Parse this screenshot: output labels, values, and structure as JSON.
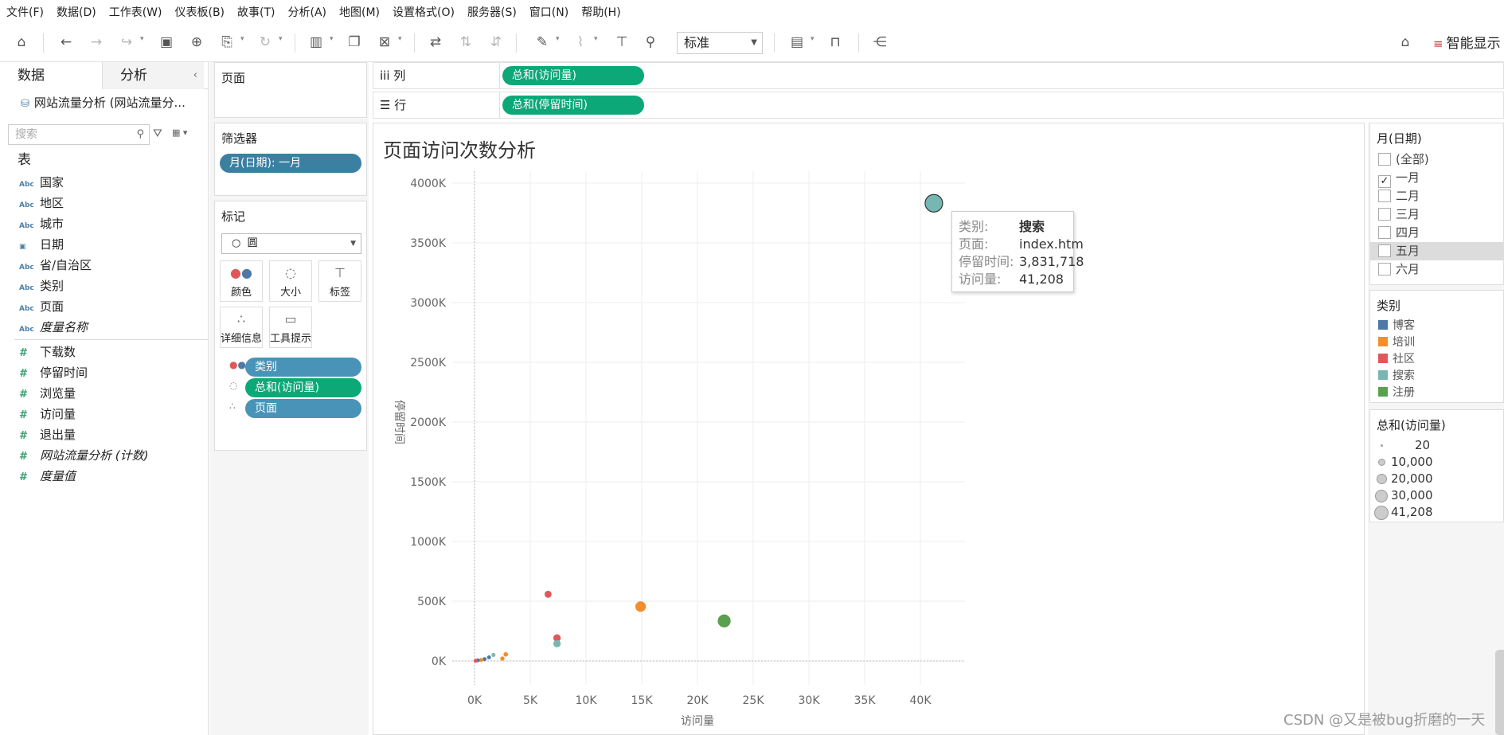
{
  "menu": [
    "文件(F)",
    "数据(D)",
    "工作表(W)",
    "仪表板(B)",
    "故事(T)",
    "分析(A)",
    "地图(M)",
    "设置格式(O)",
    "服务器(S)",
    "窗口(N)",
    "帮助(H)"
  ],
  "toolbar": {
    "fit_value": "标准",
    "smart_label": "智能显示"
  },
  "data_pane": {
    "tabs": [
      "数据",
      "分析"
    ],
    "datasource": "网站流量分析 (网站流量分...",
    "search_placeholder": "搜索",
    "table_header": "表",
    "dimensions": [
      {
        "type": "Abc",
        "name": "国家",
        "italic": false
      },
      {
        "type": "Abc",
        "name": "地区",
        "italic": false
      },
      {
        "type": "Abc",
        "name": "城市",
        "italic": false
      },
      {
        "type": "date",
        "name": "日期",
        "italic": false
      },
      {
        "type": "Abc",
        "name": "省/自治区",
        "italic": false
      },
      {
        "type": "Abc",
        "name": "类别",
        "italic": false
      },
      {
        "type": "Abc",
        "name": "页面",
        "italic": false
      },
      {
        "type": "Abc",
        "name": "度量名称",
        "italic": true
      }
    ],
    "measures": [
      {
        "name": "下载数",
        "italic": false
      },
      {
        "name": "停留时间",
        "italic": false
      },
      {
        "name": "浏览量",
        "italic": false
      },
      {
        "name": "访问量",
        "italic": false
      },
      {
        "name": "退出量",
        "italic": false
      },
      {
        "name": "网站流量分析 (计数)",
        "italic": true
      },
      {
        "name": "度量值",
        "italic": true
      }
    ]
  },
  "shelves": {
    "pages_title": "页面",
    "filters_title": "筛选器",
    "filter_pill": "月(日期): 一月",
    "marks_title": "标记",
    "mark_type": "圆",
    "mark_buttons": [
      "颜色",
      "大小",
      "标签",
      "详细信息",
      "工具提示"
    ],
    "mark_pills": [
      "类别",
      "总和(访问量)",
      "页面"
    ],
    "columns_label": "列",
    "columns_pill": "总和(访问量)",
    "rows_label": "行",
    "rows_pill": "总和(停留时间)"
  },
  "view": {
    "title": "页面访问次数分析"
  },
  "tooltip": {
    "rows": [
      {
        "k": "类别:",
        "v": "搜索",
        "bold": true
      },
      {
        "k": "页面:",
        "v": "index.htm",
        "bold": false
      },
      {
        "k": "停留时间:",
        "v": "3,831,718",
        "bold": false
      },
      {
        "k": "访问量:",
        "v": "41,208",
        "bold": false
      }
    ]
  },
  "legends": {
    "month_title": "月(日期)",
    "months": [
      {
        "label": "(全部)",
        "checked": false
      },
      {
        "label": "一月",
        "checked": true
      },
      {
        "label": "二月",
        "checked": false
      },
      {
        "label": "三月",
        "checked": false
      },
      {
        "label": "四月",
        "checked": false
      },
      {
        "label": "五月",
        "checked": false
      },
      {
        "label": "六月",
        "checked": false
      }
    ],
    "color_title": "类别",
    "colors": [
      {
        "label": "博客",
        "color": "#4e79a7"
      },
      {
        "label": "培训",
        "color": "#f28e2b"
      },
      {
        "label": "社区",
        "color": "#e15759"
      },
      {
        "label": "搜索",
        "color": "#76b7b2"
      },
      {
        "label": "注册",
        "color": "#59a14f"
      }
    ],
    "size_title": "总和(访问量)",
    "sizes": [
      "20",
      "10,000",
      "20,000",
      "30,000",
      "41,208"
    ]
  },
  "watermark": "CSDN @又是被bug折磨的一天",
  "chart_data": {
    "type": "scatter",
    "title": "页面访问次数分析",
    "xlabel": "访问量",
    "ylabel": "停留时间",
    "xlim": [
      -2000,
      44000
    ],
    "ylim": [
      -200000,
      4100000
    ],
    "x_ticks": [
      0,
      5000,
      10000,
      15000,
      20000,
      25000,
      30000,
      35000,
      40000
    ],
    "x_tick_labels": [
      "0K",
      "5K",
      "10K",
      "15K",
      "20K",
      "25K",
      "30K",
      "35K",
      "40K"
    ],
    "y_ticks": [
      0,
      500000,
      1000000,
      1500000,
      2000000,
      2500000,
      3000000,
      3500000,
      4000000
    ],
    "y_tick_labels": [
      "0K",
      "500K",
      "1000K",
      "1500K",
      "2000K",
      "2500K",
      "3000K",
      "3500K",
      "4000K"
    ],
    "grid": true,
    "points": [
      {
        "category": "搜索",
        "page": "index.htm",
        "x": 41208,
        "y": 3831718
      },
      {
        "category": "注册",
        "x": 22400,
        "y": 335000
      },
      {
        "category": "培训",
        "x": 14900,
        "y": 455000
      },
      {
        "category": "社区",
        "x": 6600,
        "y": 558000
      },
      {
        "category": "社区",
        "x": 7400,
        "y": 192000
      },
      {
        "category": "搜索",
        "x": 7400,
        "y": 145000
      },
      {
        "category": "培训",
        "x": 2800,
        "y": 55000
      },
      {
        "category": "培训",
        "x": 2500,
        "y": 20000
      },
      {
        "category": "搜索",
        "x": 1700,
        "y": 50000
      },
      {
        "category": "博客",
        "x": 1300,
        "y": 30000
      },
      {
        "category": "博客",
        "x": 900,
        "y": 15000
      },
      {
        "category": "培训",
        "x": 600,
        "y": 8000
      },
      {
        "category": "博客",
        "x": 300,
        "y": 5000
      },
      {
        "category": "社区",
        "x": 100,
        "y": 2000
      }
    ]
  }
}
